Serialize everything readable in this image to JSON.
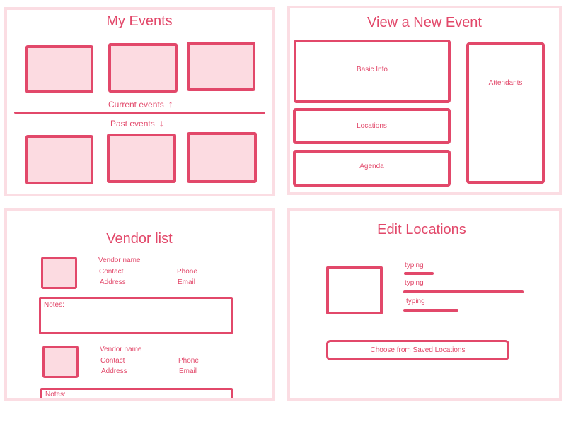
{
  "my_events": {
    "title": "My Events",
    "current_label": "Current events",
    "past_label": "Past events",
    "current_arrow": "↑",
    "past_arrow": "↓"
  },
  "new_event": {
    "title": "View a New Event",
    "basic_info": "Basic Info",
    "locations": "Locations",
    "agenda": "Agenda",
    "attendants": "Attendants"
  },
  "vendor_list": {
    "title": "Vendor list",
    "vendors": [
      {
        "name": "Vendor name",
        "contact": "Contact",
        "phone": "Phone",
        "address": "Address",
        "email": "Email",
        "notes_label": "Notes:"
      },
      {
        "name": "Vendor name",
        "contact": "Contact",
        "phone": "Phone",
        "address": "Address",
        "email": "Email",
        "notes_label": "Notes:"
      }
    ]
  },
  "edit_locations": {
    "title": "Edit Locations",
    "fields": [
      "typing",
      "typing",
      "typing"
    ],
    "saved_button": "Choose from Saved Locations"
  },
  "colors": {
    "accent": "#e2486a",
    "card_fill": "#fcdbe1",
    "panel_border": "#fbdde3"
  }
}
